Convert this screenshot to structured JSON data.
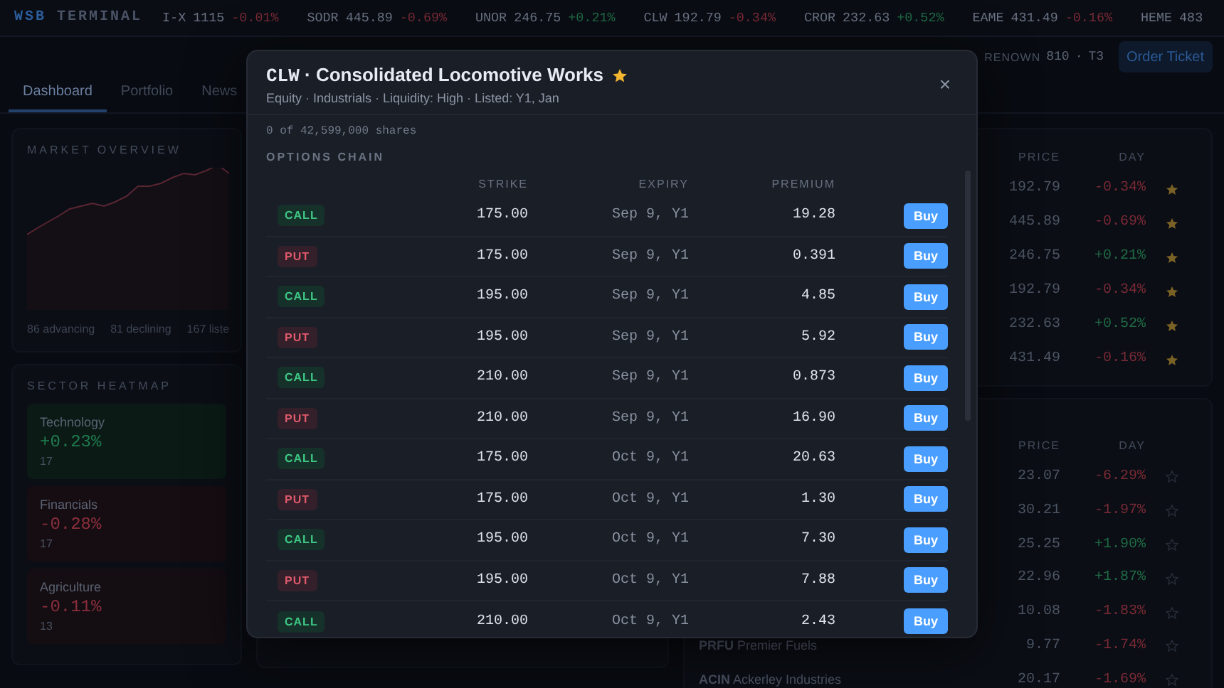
{
  "brand": {
    "first": "WSB",
    "second": "TERMINAL"
  },
  "ticker": [
    {
      "symbol": "I-X",
      "price": "1115",
      "change": "-0.01%",
      "color": "#7a2a35"
    },
    {
      "symbol": "SODR",
      "price": "445.89",
      "change": "-0.69%",
      "color": "#7a2a35"
    },
    {
      "symbol": "UNOR",
      "price": "246.75",
      "change": "+0.21%",
      "color": "#1f6b45"
    },
    {
      "symbol": "CLW",
      "price": "192.79",
      "change": "-0.34%",
      "color": "#7a2a35"
    },
    {
      "symbol": "CROR",
      "price": "232.63",
      "change": "+0.52%",
      "color": "#1f6b45"
    },
    {
      "symbol": "EAME",
      "price": "431.49",
      "change": "-0.16%",
      "color": "#7a2a35"
    },
    {
      "symbol": "HEME",
      "price": "483"
    }
  ],
  "account": {
    "rank": "RENOWN",
    "points": "810",
    "separator": "·",
    "tier": "T3"
  },
  "order_button": "Order Ticket",
  "tabs": [
    {
      "label": "Dashboard",
      "selected": true
    },
    {
      "label": "Portfolio",
      "selected": false
    },
    {
      "label": "News",
      "selected": false
    }
  ],
  "market_overview": {
    "title": "MARKET OVERVIEW",
    "stats": [
      "86 advancing",
      "81 declining",
      "167 liste"
    ]
  },
  "sector_heatmap": {
    "title": "SECTOR HEATMAP",
    "sectors": [
      {
        "name": "Technology",
        "change": "+0.23%",
        "count": "17",
        "color": "#0b1a15"
      },
      {
        "name": "Financials",
        "change": "-0.28%",
        "count": "17",
        "color": "#160d12"
      },
      {
        "name": "Agriculture",
        "change": "-0.11%",
        "count": "13",
        "color": "#140d12"
      }
    ]
  },
  "watchlist": {
    "columns": [
      "PRICE",
      "DAY"
    ],
    "rows": [
      {
        "price": "192.79",
        "day": "-0.34%",
        "color": "#7a2a35",
        "starred": true
      },
      {
        "price": "445.89",
        "day": "-0.69%",
        "color": "#7a2a35",
        "starred": true
      },
      {
        "price": "246.75",
        "day": "+0.21%",
        "color": "#1f6b45",
        "starred": true
      },
      {
        "price": "192.79",
        "day": "-0.34%",
        "color": "#7a2a35",
        "starred": true
      },
      {
        "price": "232.63",
        "day": "+0.52%",
        "color": "#1f6b45",
        "starred": true
      },
      {
        "price": "431.49",
        "day": "-0.16%",
        "color": "#7a2a35",
        "starred": true
      }
    ]
  },
  "movers": {
    "columns": [
      "PRICE",
      "DAY"
    ],
    "rows": [
      {
        "price": "23.07",
        "day": "-6.29%",
        "color": "#7a2a35",
        "starred": false
      },
      {
        "price": "30.21",
        "day": "-1.97%",
        "color": "#7a2a35",
        "starred": false
      },
      {
        "price": "25.25",
        "day": "+1.90%",
        "color": "#1f6b45",
        "starred": false
      },
      {
        "price": "22.96",
        "day": "+1.87%",
        "color": "#1f6b45",
        "starred": false
      },
      {
        "price": "10.08",
        "day": "-1.83%",
        "color": "#7a2a35",
        "starred": false
      },
      {
        "symbol": "PRFU",
        "name": "Premier Fuels",
        "price": "9.77",
        "day": "-1.74%",
        "color": "#7a2a35",
        "starred": false
      },
      {
        "symbol": "ACIN",
        "name": "Ackerley Industries",
        "price": "20.17",
        "day": "-1.69%",
        "color": "#7a2a35",
        "starred": false
      }
    ]
  },
  "modal": {
    "symbol": "CLW",
    "name": "· Consolidated Locomotive Works",
    "starred": true,
    "close": "×",
    "subtitle": "Equity · Industrials · Liquidity: High · Listed: Y1, Jan",
    "holdings": "0 of 42,599,000 shares",
    "section_title": "OPTIONS CHAIN",
    "columns": [
      "STRIKE",
      "EXPIRY",
      "PREMIUM"
    ],
    "options": [
      {
        "kind": "call",
        "type": "CALL",
        "strike": "175.00",
        "expiry": "Sep 9, Y1",
        "premium": "19.28",
        "action": "Buy"
      },
      {
        "kind": "put",
        "type": "PUT",
        "strike": "175.00",
        "expiry": "Sep 9, Y1",
        "premium": "0.391",
        "action": "Buy"
      },
      {
        "kind": "call",
        "type": "CALL",
        "strike": "195.00",
        "expiry": "Sep 9, Y1",
        "premium": "4.85",
        "action": "Buy"
      },
      {
        "kind": "put",
        "type": "PUT",
        "strike": "195.00",
        "expiry": "Sep 9, Y1",
        "premium": "5.92",
        "action": "Buy"
      },
      {
        "kind": "call",
        "type": "CALL",
        "strike": "210.00",
        "expiry": "Sep 9, Y1",
        "premium": "0.873",
        "action": "Buy"
      },
      {
        "kind": "put",
        "type": "PUT",
        "strike": "210.00",
        "expiry": "Sep 9, Y1",
        "premium": "16.90",
        "action": "Buy"
      },
      {
        "kind": "call",
        "type": "CALL",
        "strike": "175.00",
        "expiry": "Oct 9, Y1",
        "premium": "20.63",
        "action": "Buy"
      },
      {
        "kind": "put",
        "type": "PUT",
        "strike": "175.00",
        "expiry": "Oct 9, Y1",
        "premium": "1.30",
        "action": "Buy"
      },
      {
        "kind": "call",
        "type": "CALL",
        "strike": "195.00",
        "expiry": "Oct 9, Y1",
        "premium": "7.30",
        "action": "Buy"
      },
      {
        "kind": "put",
        "type": "PUT",
        "strike": "195.00",
        "expiry": "Oct 9, Y1",
        "premium": "7.88",
        "action": "Buy"
      },
      {
        "kind": "call",
        "type": "CALL",
        "strike": "210.00",
        "expiry": "Oct 9, Y1",
        "premium": "2.43",
        "action": "Buy"
      }
    ]
  }
}
